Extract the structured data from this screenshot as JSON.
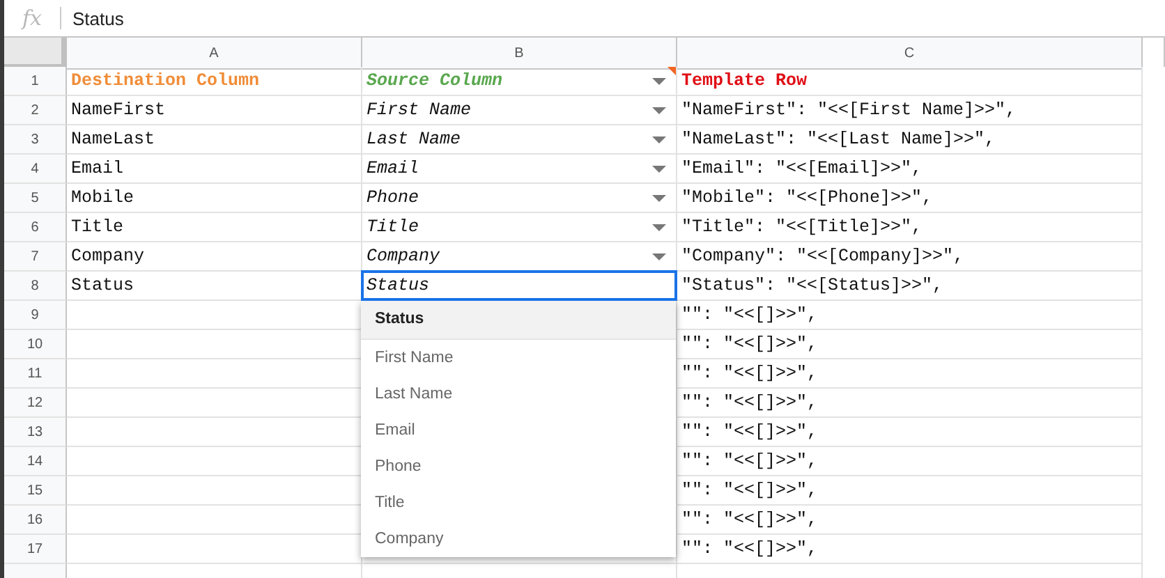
{
  "formula_bar": {
    "icon": "fx",
    "value": "Status"
  },
  "columns": [
    {
      "label": "A"
    },
    {
      "label": "B"
    },
    {
      "label": "C"
    }
  ],
  "rows": [
    {
      "number": "1",
      "kind": "header",
      "destination": "Destination Column",
      "source": "Source Column",
      "template": "Template Row",
      "editing": false,
      "note": true
    },
    {
      "number": "2",
      "kind": "data",
      "destination": "NameFirst",
      "source": "First Name",
      "template": "\"NameFirst\": \"<<[First Name]>>\",",
      "editing": false
    },
    {
      "number": "3",
      "kind": "data",
      "destination": "NameLast",
      "source": "Last Name",
      "template": "\"NameLast\": \"<<[Last Name]>>\",",
      "editing": false
    },
    {
      "number": "4",
      "kind": "data",
      "destination": "Email",
      "source": "Email",
      "template": "\"Email\": \"<<[Email]>>\",",
      "editing": false
    },
    {
      "number": "5",
      "kind": "data",
      "destination": "Mobile",
      "source": "Phone",
      "template": "\"Mobile\": \"<<[Phone]>>\",",
      "editing": false
    },
    {
      "number": "6",
      "kind": "data",
      "destination": "Title",
      "source": "Title",
      "template": "\"Title\": \"<<[Title]>>\",",
      "editing": false
    },
    {
      "number": "7",
      "kind": "data",
      "destination": "Company",
      "source": "Company",
      "template": "\"Company\": \"<<[Company]>>\",",
      "editing": false
    },
    {
      "number": "8",
      "kind": "data",
      "destination": "Status",
      "source": "Status",
      "template": "\"Status\": \"<<[Status]>>\",",
      "editing": true
    },
    {
      "number": "9",
      "kind": "empty",
      "template": "\"\": \"<<[]>>\","
    },
    {
      "number": "10",
      "kind": "empty",
      "template": "\"\": \"<<[]>>\","
    },
    {
      "number": "11",
      "kind": "empty",
      "template": "\"\": \"<<[]>>\","
    },
    {
      "number": "12",
      "kind": "empty",
      "template": "\"\": \"<<[]>>\","
    },
    {
      "number": "13",
      "kind": "empty",
      "template": "\"\": \"<<[]>>\","
    },
    {
      "number": "14",
      "kind": "empty",
      "template": "\"\": \"<<[]>>\","
    },
    {
      "number": "15",
      "kind": "empty",
      "template": "\"\": \"<<[]>>\","
    },
    {
      "number": "16",
      "kind": "empty",
      "template": "\"\": \"<<[]>>\","
    },
    {
      "number": "17",
      "kind": "empty",
      "template": "\"\": \"<<[]>>\","
    }
  ],
  "suggestions": [
    {
      "label": "Status",
      "selected": true
    },
    {
      "label": "First Name",
      "selected": false
    },
    {
      "label": "Last Name",
      "selected": false
    },
    {
      "label": "Email",
      "selected": false
    },
    {
      "label": "Phone",
      "selected": false
    },
    {
      "label": "Title",
      "selected": false
    },
    {
      "label": "Company",
      "selected": false
    }
  ]
}
